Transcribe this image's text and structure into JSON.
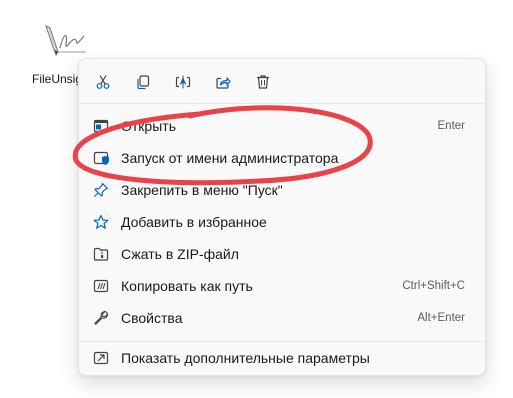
{
  "desktop": {
    "file_label": "FileUnsig",
    "file_icon": "signature-file-icon"
  },
  "menu": {
    "toolbar": [
      {
        "name": "cut-icon",
        "action": "cut"
      },
      {
        "name": "copy-icon",
        "action": "copy"
      },
      {
        "name": "rename-icon",
        "action": "rename"
      },
      {
        "name": "share-icon",
        "action": "share"
      },
      {
        "name": "delete-icon",
        "action": "delete"
      }
    ],
    "items": [
      {
        "label": "Открыть",
        "shortcut": "Enter",
        "icon": "open-app-icon"
      },
      {
        "label": "Запуск от имени администратора",
        "shortcut": "",
        "icon": "shield-icon"
      },
      {
        "label": "Закрепить в меню \"Пуск\"",
        "shortcut": "",
        "icon": "pin-icon"
      },
      {
        "label": "Добавить в избранное",
        "shortcut": "",
        "icon": "star-icon"
      },
      {
        "label": "Сжать в ZIP-файл",
        "shortcut": "",
        "icon": "zip-folder-icon"
      },
      {
        "label": "Копировать как путь",
        "shortcut": "Ctrl+Shift+C",
        "icon": "copy-path-icon"
      },
      {
        "label": "Свойства",
        "shortcut": "Alt+Enter",
        "icon": "wrench-icon"
      },
      {
        "label": "Показать дополнительные параметры",
        "shortcut": "",
        "icon": "more-options-icon"
      }
    ]
  },
  "colors": {
    "accent": "#0067c0",
    "annotation_red": "#e8434a"
  }
}
